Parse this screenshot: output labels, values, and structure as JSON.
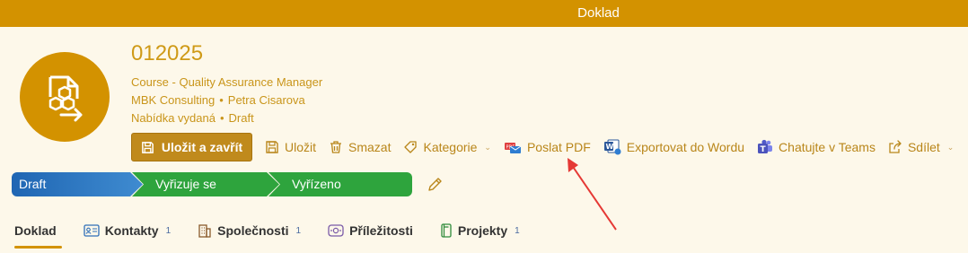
{
  "window": {
    "title": "Doklad"
  },
  "record": {
    "number": "012025",
    "name": "Course - Quality Assurance Manager",
    "company": "MBK Consulting",
    "contact": "Petra Cisarova",
    "offer_status": "Nabídka vydaná",
    "state": "Draft",
    "separator": "•"
  },
  "toolbar": {
    "save_close": "Uložit a zavřít",
    "save": "Uložit",
    "delete": "Smazat",
    "category": "Kategorie",
    "send_pdf": "Poslat PDF",
    "export_word": "Exportovat do Wordu",
    "teams": "Chatujte v Teams",
    "share": "Sdílet"
  },
  "stages": [
    {
      "label": "Draft"
    },
    {
      "label": "Vyřizuje se"
    },
    {
      "label": "Vyřízeno"
    }
  ],
  "tabs": [
    {
      "label": "Doklad",
      "count": ""
    },
    {
      "label": "Kontakty",
      "count": "1"
    },
    {
      "label": "Společnosti",
      "count": "1"
    },
    {
      "label": "Příležitosti",
      "count": ""
    },
    {
      "label": "Projekty",
      "count": "1"
    }
  ],
  "colors": {
    "accent": "#d39200",
    "accent_text": "#c9951a",
    "stage_blue": "#1f66b3",
    "stage_green": "#2ea43d",
    "arrow": "#e53935"
  }
}
